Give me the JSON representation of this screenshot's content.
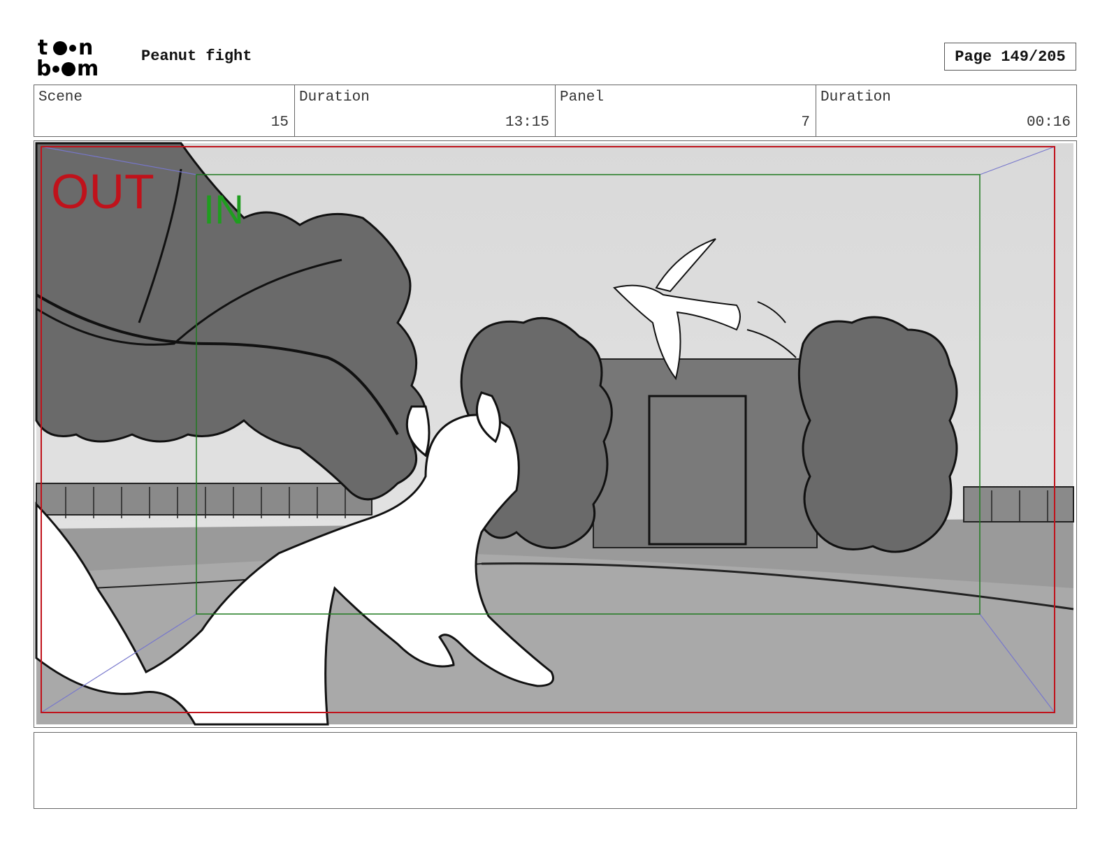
{
  "header": {
    "logo_alt": "toon boom",
    "project_title": "Peanut fight",
    "page_label": "Page 149/205"
  },
  "info": {
    "scene_label": "Scene",
    "scene_value": "15",
    "scene_duration_label": "Duration",
    "scene_duration_value": "13:15",
    "panel_label": "Panel",
    "panel_value": "7",
    "panel_duration_label": "Duration",
    "panel_duration_value": "00:16"
  },
  "panel": {
    "out_label": "OUT",
    "in_label": "IN",
    "out_color": "#c0121b",
    "in_color": "#1f9d1f"
  },
  "notes": {
    "text": ""
  }
}
